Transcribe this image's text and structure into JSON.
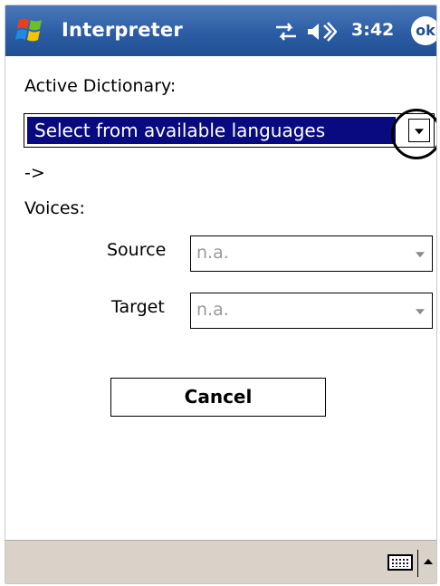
{
  "titlebar": {
    "app_title": "Interpreter",
    "clock": "3:42",
    "ok_label": "ok",
    "icons": [
      "windows-start-icon",
      "sync-icon",
      "speaker-icon"
    ],
    "color": "#2c5da4"
  },
  "form": {
    "active_dictionary_label": "Active Dictionary:",
    "dictionary_selected": "Select from available languages",
    "arrow_text": "->",
    "voices_label": "Voices:",
    "source_label": "Source",
    "source_value": "n.a.",
    "target_label": "Target",
    "target_value": "n.a.",
    "cancel_label": "Cancel",
    "selection_color": "#0a0a80"
  },
  "bottombar": {
    "icons": [
      "keyboard-icon",
      "input-menu-up-icon"
    ],
    "color": "#d8d2c8"
  }
}
